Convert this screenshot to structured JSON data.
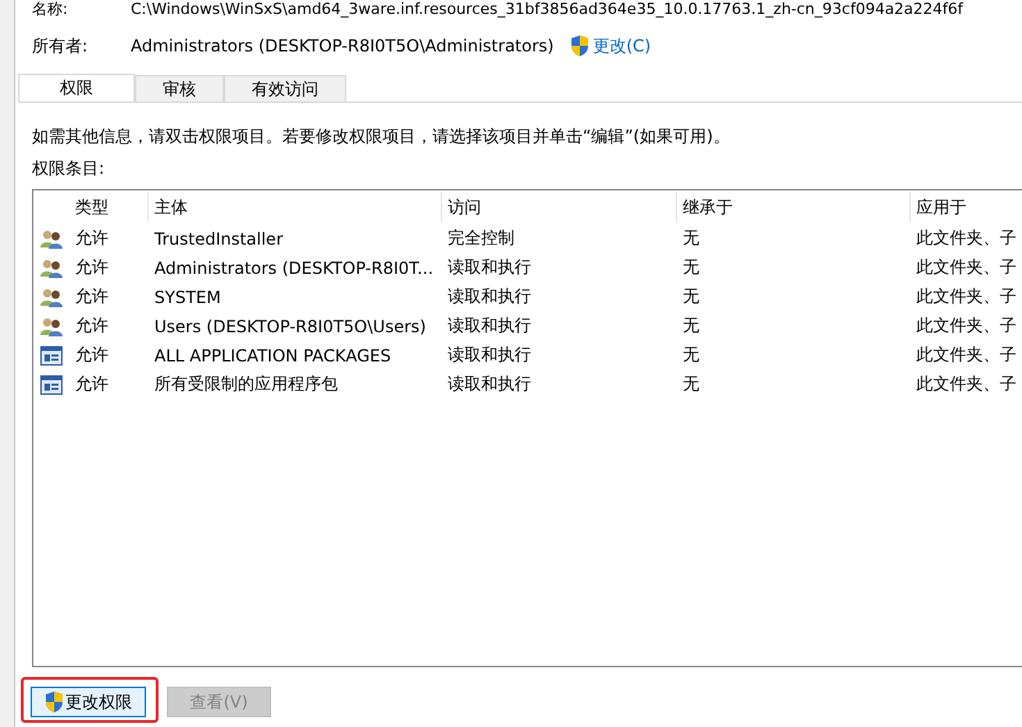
{
  "name_row": {
    "label": "名称:",
    "value": "C:\\Windows\\WinSxS\\amd64_3ware.inf.resources_31bf3856ad364e35_10.0.17763.1_zh-cn_93cf094a2a224f6f"
  },
  "owner_row": {
    "label": "所有者:",
    "value": "Administrators (DESKTOP-R8I0T5O\\Administrators)",
    "link": "更改(C)"
  },
  "tabs": [
    {
      "label": "权限",
      "selected": true
    },
    {
      "label": "审核",
      "selected": false
    },
    {
      "label": "有效访问",
      "selected": false
    }
  ],
  "info": "如需其他信息，请双击权限项目。若要修改权限项目，请选择该项目并单击“编辑”(如果可用)。",
  "list_label": "权限条目:",
  "table": {
    "columns": [
      "类型",
      "主体",
      "访问",
      "继承于",
      "应用于"
    ],
    "rows": [
      {
        "kind": "user",
        "cells": [
          "允许",
          "TrustedInstaller",
          "完全控制",
          "无",
          "此文件夹、子"
        ]
      },
      {
        "kind": "user",
        "cells": [
          "允许",
          "Administrators (DESKTOP-R8I0T...",
          "读取和执行",
          "无",
          "此文件夹、子"
        ]
      },
      {
        "kind": "user",
        "cells": [
          "允许",
          "SYSTEM",
          "读取和执行",
          "无",
          "此文件夹、子"
        ]
      },
      {
        "kind": "user",
        "cells": [
          "允许",
          "Users (DESKTOP-R8I0T5O\\Users)",
          "读取和执行",
          "无",
          "此文件夹、子"
        ]
      },
      {
        "kind": "package",
        "cells": [
          "允许",
          "ALL APPLICATION PACKAGES",
          "读取和执行",
          "无",
          "此文件夹、子"
        ]
      },
      {
        "kind": "package",
        "cells": [
          "允许",
          "所有受限制的应用程序包",
          "读取和执行",
          "无",
          "此文件夹、子"
        ]
      }
    ]
  },
  "buttons": [
    {
      "label": "更改权限",
      "disabled": false,
      "highlighted": true
    },
    {
      "label": "查看(V)",
      "disabled": true,
      "highlighted": false
    }
  ]
}
